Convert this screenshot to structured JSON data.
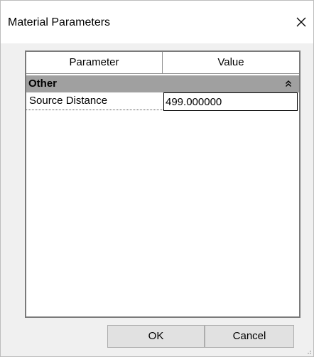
{
  "dialog": {
    "title": "Material Parameters",
    "close_icon": "close-x-icon"
  },
  "grid": {
    "headers": {
      "parameter": "Parameter",
      "value": "Value"
    },
    "categories": [
      {
        "label": "Other",
        "expanded": true,
        "collapse_icon": "double-chevron-up-icon",
        "properties": [
          {
            "name": "Source Distance",
            "value": "499.000000"
          }
        ]
      }
    ]
  },
  "buttons": {
    "ok_label": "OK",
    "cancel_label": "Cancel"
  },
  "colors": {
    "dialog_background": "#f0f0f0",
    "category_background": "#a0a0a0",
    "button_background": "#e1e1e1"
  }
}
